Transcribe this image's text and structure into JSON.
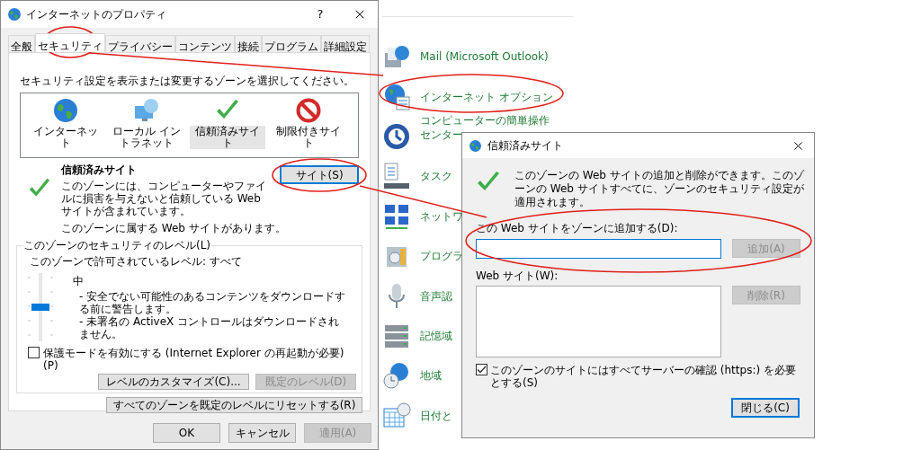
{
  "properties_dialog": {
    "title": "インターネットのプロパティ",
    "help": "?",
    "tabs": [
      {
        "label": "全般",
        "selected": false
      },
      {
        "label": "セキュリティ",
        "selected": true
      },
      {
        "label": "プライバシー",
        "selected": false
      },
      {
        "label": "コンテンツ",
        "selected": false
      },
      {
        "label": "接続",
        "selected": false
      },
      {
        "label": "プログラム",
        "selected": false
      },
      {
        "label": "詳細設定",
        "selected": false
      }
    ],
    "zone_prompt": "セキュリティ設定を表示または変更するゾーンを選択してください。",
    "zones": [
      {
        "kind": "internet",
        "label": "インターネット",
        "selected": false
      },
      {
        "kind": "intranet",
        "label": "ローカル イントラネット",
        "selected": false
      },
      {
        "kind": "trusted",
        "label": "信頼済みサイト",
        "selected": true
      },
      {
        "kind": "restricted",
        "label": "制限付きサイト",
        "selected": false
      }
    ],
    "zone_info": {
      "title": "信頼済みサイト",
      "description": "このゾーンには、コンピューターやファイルに損害を与えないと信頼している Web サイトが含まれています。",
      "button": "サイト(S)"
    },
    "zone_note": "このゾーンに属する Web サイトがあります。",
    "security_level": {
      "legend": "このゾーンのセキュリティのレベル(L)",
      "allowed": "このゾーンで許可されているレベル: すべて",
      "level": 0.5,
      "name": "中",
      "bullets": [
        "- 安全でない可能性のあるコンテンツをダウンロードする前に警告します。",
        "- 未署名の ActiveX コントロールはダウンロードされません。"
      ],
      "protected_mode": {
        "label": "保護モードを有効にする (Internet Explorer の再起動が必要)(P)",
        "checked": false
      },
      "buttons": [
        {
          "label": "レベルのカスタマイズ(C)...",
          "disabled": false
        },
        {
          "label": "既定のレベル(D)",
          "disabled": true
        }
      ]
    },
    "reset_button": "すべてのゾーンを既定のレベルにリセットする(R)",
    "footer_buttons": [
      {
        "label": "OK",
        "disabled": false
      },
      {
        "label": "キャンセル",
        "disabled": false
      },
      {
        "label": "適用(A)",
        "disabled": true
      }
    ]
  },
  "control_panel": {
    "items": [
      {
        "kind": "mail",
        "label": "Mail (Microsoft Outlook)"
      },
      {
        "kind": "internet",
        "label": "インターネット オプション"
      },
      {
        "kind": "access",
        "label": "コンピューターの簡単操作センター"
      },
      {
        "kind": "taskbar",
        "label": "タスク"
      },
      {
        "kind": "network",
        "label": "ネットワ"
      },
      {
        "kind": "programs",
        "label": "プログラ"
      },
      {
        "kind": "speech",
        "label": "音声認"
      },
      {
        "kind": "storage",
        "label": "記憶域"
      },
      {
        "kind": "region",
        "label": "地域"
      },
      {
        "kind": "date",
        "label": "日付と"
      }
    ]
  },
  "trusted_sites_dialog": {
    "title": "信頼済みサイト",
    "message": "このゾーンの Web サイトの追加と削除ができます。このゾーンの Web サイトすべてに、ゾーンのセキュリティ設定が適用されます。",
    "add_label": "この Web サイトをゾーンに追加する(D):",
    "add_button": {
      "label": "追加(A)",
      "disabled": true
    },
    "list_label": "Web サイト(W):",
    "remove_button": {
      "label": "削除(R)",
      "disabled": true
    },
    "https_check": {
      "label": "このゾーンのサイトにはすべてサーバーの確認 (https:) を必要とする(S)",
      "checked": true
    },
    "close_button": "閉じる(C)"
  }
}
